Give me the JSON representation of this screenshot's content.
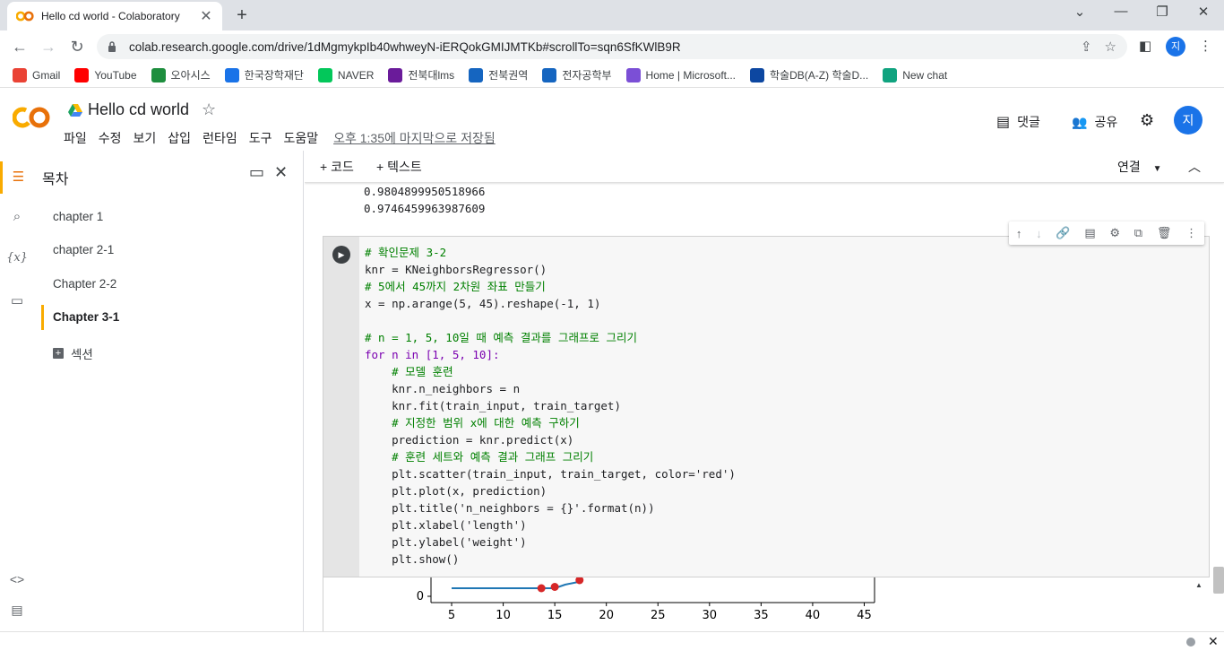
{
  "browser": {
    "tab_title": "Hello cd world - Colaboratory",
    "url": "colab.research.google.com/drive/1dMgmykpIb40whweyN-iERQokGMIJMTKb#scrollTo=sqn6SfKWlB9R",
    "profile_initial": "지",
    "bookmarks": [
      {
        "label": "Gmail",
        "icon": "gmail-icon",
        "color": "#ea4335"
      },
      {
        "label": "YouTube",
        "icon": "youtube-icon",
        "color": "#ff0000"
      },
      {
        "label": "오아시스",
        "icon": "oasis-icon",
        "color": "#1e8e3e"
      },
      {
        "label": "한국장학재단",
        "icon": "kosaf-icon",
        "color": "#1a73e8"
      },
      {
        "label": "NAVER",
        "icon": "naver-icon",
        "color": "#03c75a"
      },
      {
        "label": "전북대lms",
        "icon": "jbnu-lms-icon",
        "color": "#6a1b9a"
      },
      {
        "label": "전북권역",
        "icon": "jb-region-icon",
        "color": "#1565c0"
      },
      {
        "label": "전자공학부",
        "icon": "ee-dept-icon",
        "color": "#1565c0"
      },
      {
        "label": "Home | Microsoft...",
        "icon": "microsoft-icon",
        "color": "#7b4fd6"
      },
      {
        "label": "학술DB(A-Z) 학술D...",
        "icon": "library-icon",
        "color": "#0d47a1"
      },
      {
        "label": "New chat",
        "icon": "chatgpt-icon",
        "color": "#10a37f"
      }
    ]
  },
  "colab": {
    "notebook_title": "Hello cd world",
    "menu": [
      "파일",
      "수정",
      "보기",
      "삽입",
      "런타임",
      "도구",
      "도움말"
    ],
    "saved_status": "오후 1:35에 마지막으로 저장됨",
    "comment_label": "댓글",
    "share_label": "공유",
    "user_initial": "지",
    "add_code_label": "+ 코드",
    "add_text_label": "+ 텍스트",
    "connect_label": "연결"
  },
  "toc": {
    "title": "목차",
    "items": [
      "chapter 1",
      "chapter 2-1",
      "Chapter 2-2",
      "Chapter 3-1"
    ],
    "active_item": "Chapter 3-1",
    "add_section_label": "섹션"
  },
  "outputs": {
    "line1": "0.9804899950518966",
    "line2": "0.9746459963987609"
  },
  "cell_code": [
    "# 확인문제 3-2",
    "knr = KNeighborsRegressor()",
    "# 5에서 45까지 2차원 좌표 만들기",
    "x = np.arange(5, 45).reshape(-1, 1)",
    "",
    "# n = 1, 5, 10일 때 예측 결과를 그래프로 그리기",
    "for n in [1, 5, 10]:",
    "    # 모델 훈련",
    "    knr.n_neighbors = n",
    "    knr.fit(train_input, train_target)",
    "    # 지정한 범위 x에 대한 예측 구하기",
    "    prediction = knr.predict(x)",
    "    # 훈련 세트와 예측 결과 그래프 그리기",
    "    plt.scatter(train_input, train_target, color='red')",
    "    plt.plot(x, prediction)",
    "    plt.title('n_neighbors = {}'.format(n))",
    "    plt.xlabel('length')",
    "    plt.ylabel('weight')",
    "    plt.show()"
  ],
  "chart_data": {
    "type": "line",
    "x_ticks": [
      "5",
      "10",
      "15",
      "20",
      "25",
      "30",
      "35",
      "40",
      "45"
    ],
    "y_ticks": [
      "0"
    ],
    "xlim": [
      3,
      46
    ],
    "series": [
      {
        "type": "line",
        "color": "#1f77b4",
        "x": [
          5,
          15,
          16,
          17.5
        ],
        "y": [
          0,
          0,
          8,
          15
        ]
      },
      {
        "type": "scatter",
        "color": "#d62728",
        "x": [
          13.7,
          15.0,
          17.4
        ],
        "y": [
          0,
          3,
          18
        ]
      }
    ]
  }
}
